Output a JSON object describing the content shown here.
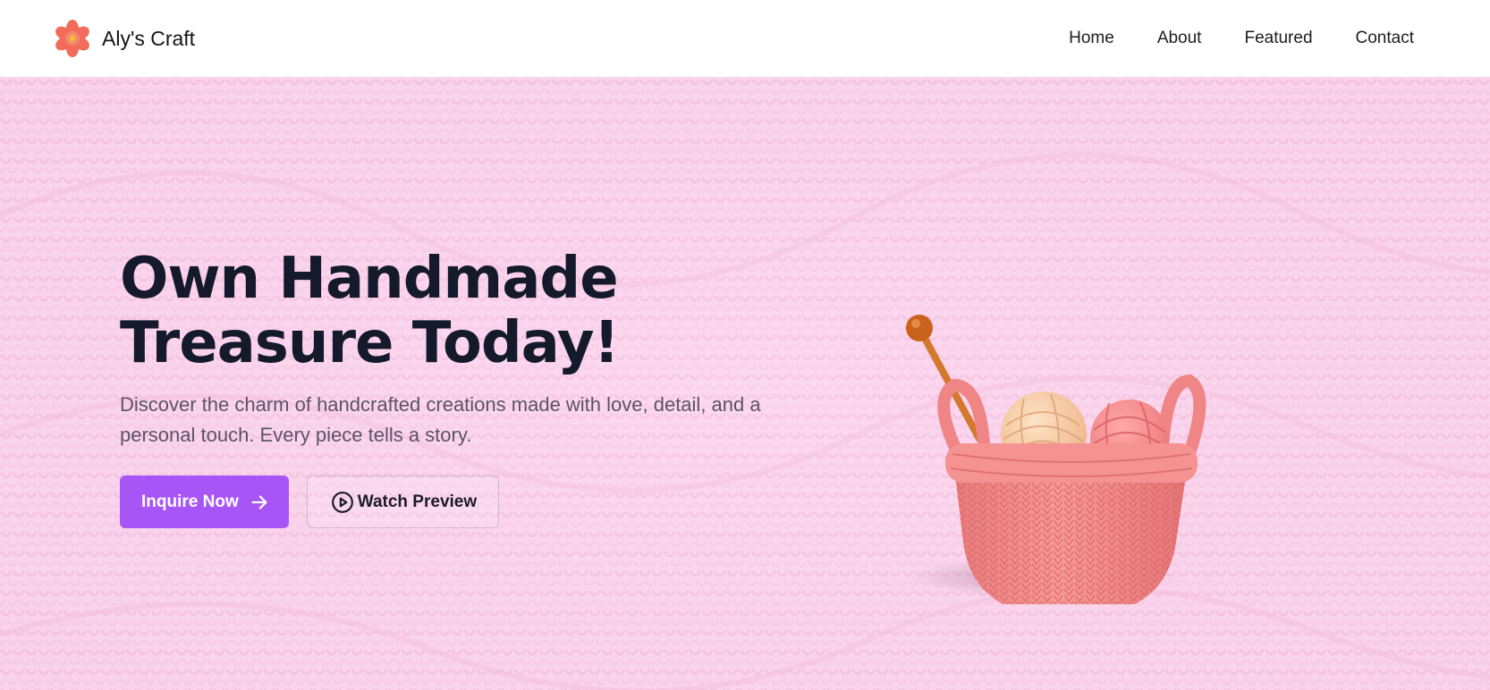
{
  "navbar": {
    "brand_name": "Aly's Craft",
    "brand_icon": "flower-icon",
    "links": [
      {
        "label": "Home"
      },
      {
        "label": "About"
      },
      {
        "label": "Featured"
      },
      {
        "label": "Contact"
      }
    ]
  },
  "hero": {
    "title_line1": "Own Handmade",
    "title_line2": "Treasure Today!",
    "subtitle": "Discover the charm of handcrafted creations made with love, detail, and a personal touch. Every piece tells a story.",
    "primary_button": {
      "label": "Inquire Now",
      "icon": "arrow-right-icon"
    },
    "secondary_button": {
      "label": "Watch Preview",
      "icon": "play-circle-icon"
    },
    "image": "knitted-yarn-basket"
  },
  "colors": {
    "accent": "#a855f7",
    "hero_background": "#fcd8ef",
    "title": "#141a2c",
    "basket": "#f48c8c"
  }
}
